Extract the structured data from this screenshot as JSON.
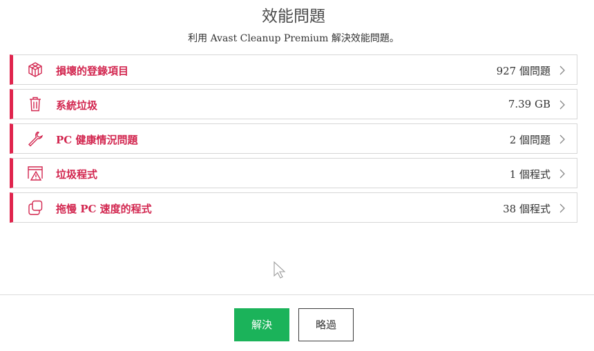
{
  "header": {
    "title": "效能問題",
    "subtitle": "利用 Avast Cleanup Premium 解決效能問題。"
  },
  "issues": [
    {
      "icon": "registry-cube-icon",
      "label": "損壞的登錄項目",
      "count": "927 個問題"
    },
    {
      "icon": "trash-icon",
      "label": "系統垃圾",
      "count": "7.39 GB"
    },
    {
      "icon": "wrench-icon",
      "label": "PC 健康情況問題",
      "count": "2 個問題"
    },
    {
      "icon": "warning-window-icon",
      "label": "垃圾程式",
      "count": "1 個程式"
    },
    {
      "icon": "copy-windows-icon",
      "label": "拖慢 PC 速度的程式",
      "count": "38 個程式"
    }
  ],
  "footer": {
    "primary_label": "解決",
    "secondary_label": "略過"
  },
  "colors": {
    "accent": "#e0244d",
    "primary_button": "#1bb35a"
  }
}
